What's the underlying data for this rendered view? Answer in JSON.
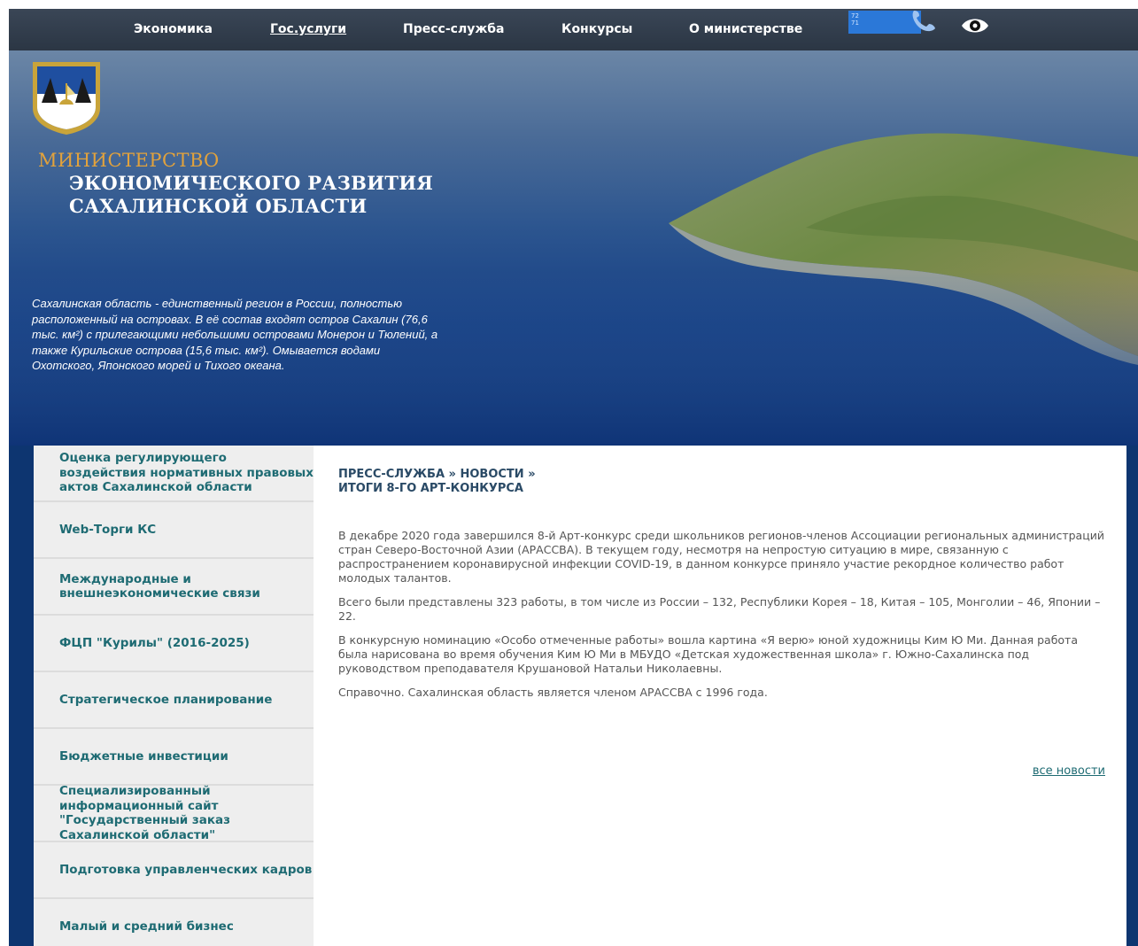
{
  "nav": {
    "items": [
      {
        "label": "Экономика",
        "active": false
      },
      {
        "label": "Гос.услуги",
        "active": true
      },
      {
        "label": "Пресс-служба",
        "active": false
      },
      {
        "label": "Конкурсы",
        "active": false
      },
      {
        "label": "О министерстве",
        "active": false
      }
    ],
    "font_size_labels": [
      "72",
      "71"
    ],
    "icons": [
      "phone-icon",
      "eye-icon"
    ]
  },
  "banner": {
    "title_line1": "МИНИСТЕРСТВО",
    "title_line2": "ЭКОНОМИЧЕСКОГО РАЗВИТИЯ",
    "title_line3": "САХАЛИНСКОЙ ОБЛАСТИ",
    "description": "Сахалинская область - единственный регион в России, полностью расположенный на островах. В её состав входят остров Сахалин (76,6 тыс. км²) с прилегающими небольшими островами Монерон и Тюлений, а также Курильские острова (15,6 тыс. км²). Омывается водами Охотского, Японского морей и Тихого океана."
  },
  "sidebar": {
    "items": [
      {
        "label": "Оценка регулирующего воздействия нормативных правовых актов Сахалинской области"
      },
      {
        "label": "Web-Торги КС"
      },
      {
        "label": "Международные и внешнеэкономические связи"
      },
      {
        "label": "ФЦП \"Курилы\" (2016-2025)"
      },
      {
        "label": "Стратегическое планирование"
      },
      {
        "label": "Бюджетные инвестиции"
      },
      {
        "label": "Специализированный информационный сайт \"Государственный заказ Сахалинской области\""
      },
      {
        "label": "Подготовка управленческих кадров"
      },
      {
        "label": "Малый и средний бизнес"
      }
    ]
  },
  "main": {
    "breadcrumb": {
      "section": "ПРЕСС-СЛУЖБА",
      "separator": "»",
      "subsection": "НОВОСТИ",
      "title": "ИТОГИ 8-ГО АРТ-КОНКУРСА"
    },
    "paragraphs": [
      "В декабре 2020 года завершился 8-й Арт-конкурс среди школьников регионов-членов Ассоциации региональных администраций стран Северо-Восточной Азии (АРАССВА). В текущем году, несмотря на непростую ситуацию в мире, связанную с распространением коронавирусной инфекции COVID-19, в данном конкурсе приняло участие рекордное количество работ молодых талантов.",
      "Всего были представлены 323 работы, в том числе из России – 132, Республики Корея – 18, Китая – 105, Монголии – 46, Японии – 22.",
      "В конкурсную номинацию «Особо отмеченные работы» вошла картина «Я верю» юной художницы Ким Ю Ми. Данная работа была нарисована во время обучения Ким Ю Ми в МБУДО «Детская художественная школа» г. Южно-Сахалинска под руководством преподавателя Крушановой Натальи Николаевны.",
      "Справочно. Сахалинская область является членом АРАССВА с 1996 года."
    ],
    "all_news_label": "все новости"
  },
  "colors": {
    "nav_bg": "#2f3b4a",
    "page_bg": "#0d3570",
    "accent_teal": "#1e6b73",
    "title_gold": "#e2a23c",
    "font_box_blue": "#2b78d8"
  }
}
